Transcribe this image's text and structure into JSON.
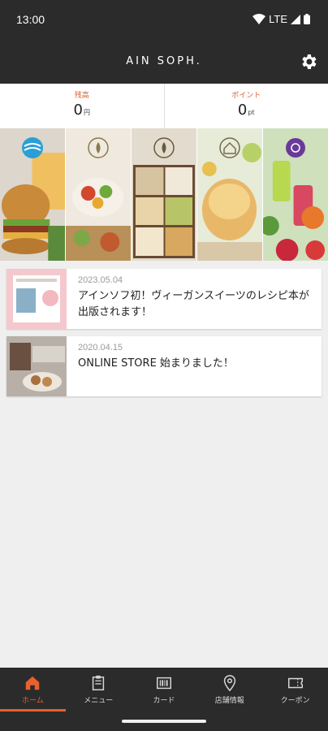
{
  "status_bar": {
    "time": "13:00",
    "network": "LTE"
  },
  "header": {
    "title": "AIN SOPH.",
    "settings_icon": "gear-icon"
  },
  "balance": {
    "cash": {
      "label": "残高",
      "value": "0",
      "unit": "円"
    },
    "points": {
      "label": "ポイント",
      "value": "0",
      "unit": "pt"
    }
  },
  "brands": [
    {
      "name": "brand-1",
      "logo": "wave-logo-icon"
    },
    {
      "name": "brand-2",
      "logo": "leaf-logo-icon"
    },
    {
      "name": "brand-3",
      "logo": "leaf-logo-icon"
    },
    {
      "name": "brand-4",
      "logo": "house-logo-icon"
    },
    {
      "name": "brand-5",
      "logo": "circle-logo-icon"
    }
  ],
  "news": [
    {
      "date": "2023.05.04",
      "title": "アインソフ初！ヴィーガンスイーツのレシピ本が出版されます！"
    },
    {
      "date": "2020.04.15",
      "title": "ONLINE STORE 始まりました！"
    }
  ],
  "nav": {
    "items": [
      {
        "label": "ホーム",
        "icon": "home-icon",
        "active": true
      },
      {
        "label": "メニュー",
        "icon": "menu-book-icon",
        "active": false
      },
      {
        "label": "カード",
        "icon": "card-icon",
        "active": false
      },
      {
        "label": "店舗情報",
        "icon": "location-pin-icon",
        "active": false
      },
      {
        "label": "クーポン",
        "icon": "coupon-icon",
        "active": false
      }
    ]
  },
  "colors": {
    "accent": "#e8602c",
    "header_bg": "#2b2b2b",
    "page_bg": "#efefef"
  }
}
